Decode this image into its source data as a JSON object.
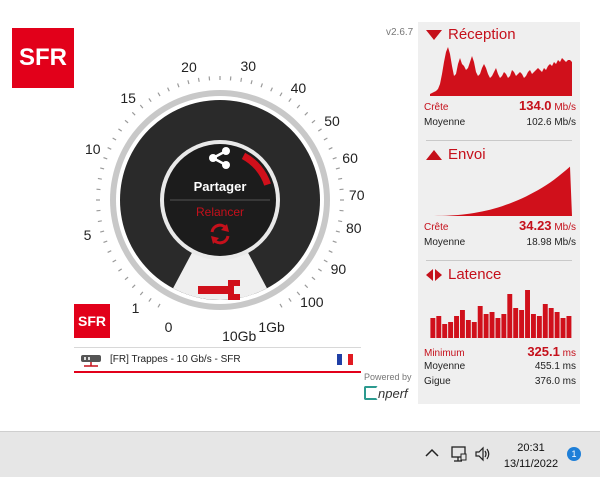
{
  "brand": {
    "logo_text": "SFR",
    "color": "#e2001a"
  },
  "version": "v2.6.7",
  "gauge": {
    "scale_labels": [
      "0",
      "1",
      "5",
      "10",
      "15",
      "20",
      "30",
      "40",
      "50",
      "60",
      "70",
      "80",
      "90",
      "100",
      "1Gb",
      "10Gb"
    ],
    "share_label": "Partager",
    "restart_label": "Relancer",
    "accent_color": "#c5101b"
  },
  "server": {
    "name": "[FR] Trappes - 10 Gb/s - SFR",
    "flag": "france-flag"
  },
  "footer": {
    "powered_by": "Powered by",
    "nperf_logo_text": "nperf"
  },
  "reception": {
    "title": "Réception",
    "peak_label": "Crête",
    "peak_value": "134.0",
    "peak_unit": "Mb/s",
    "avg_label": "Moyenne",
    "avg_value": "102.6 Mb/s"
  },
  "envoi": {
    "title": "Envoi",
    "peak_label": "Crête",
    "peak_value": "34.23",
    "peak_unit": "Mb/s",
    "avg_label": "Moyenne",
    "avg_value": "18.98 Mb/s"
  },
  "latence": {
    "title": "Latence",
    "min_label": "Minimum",
    "min_value": "325.1",
    "min_unit": "ms",
    "avg_label": "Moyenne",
    "avg_value": "455.1 ms",
    "jitter_label": "Gigue",
    "jitter_value": "376.0 ms"
  },
  "taskbar": {
    "time": "20:31",
    "date": "13/11/2022",
    "notification_count": "1",
    "icons": [
      "chevron-up-icon",
      "network-icon",
      "volume-icon"
    ]
  }
}
